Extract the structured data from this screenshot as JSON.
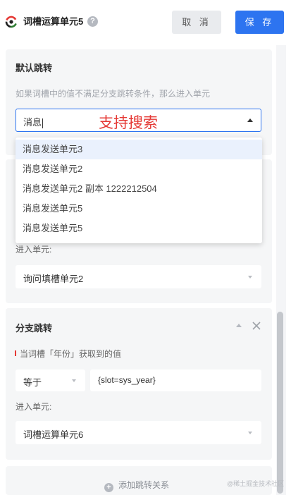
{
  "header": {
    "title": "词槽运算单元5",
    "help_icon": "?",
    "cancel_label": "取 消",
    "save_label": "保 存"
  },
  "colors": {
    "accent": "#2d74f0",
    "annotation": "#e53935",
    "card_bg": "#f5f6f7"
  },
  "default_jump": {
    "title": "默认跳转",
    "hint": "如果词槽中的值不满足分支跳转条件，那么进入单元",
    "search_value": "消息",
    "annotation": "支持搜索",
    "dropdown_items": [
      "消息发送单元3",
      "消息发送单元2",
      "消息发送单元2 副本 1222212504",
      "消息发送单元5",
      "消息发送单元5"
    ]
  },
  "branch1": {
    "enter_label": "进入单元:",
    "unit_value": "询问填槽单元2"
  },
  "branch2": {
    "title": "分支跳转",
    "slot_label": "当词槽「年份」获取到的值",
    "operator": "等于",
    "value": "{slot=sys_year}",
    "enter_label": "进入单元:",
    "unit_value": "词槽运算单元6"
  },
  "footer": {
    "add_label": "添加跳转关系",
    "plus_icon": "+",
    "watermark": "@稀土掘金技术社区"
  }
}
